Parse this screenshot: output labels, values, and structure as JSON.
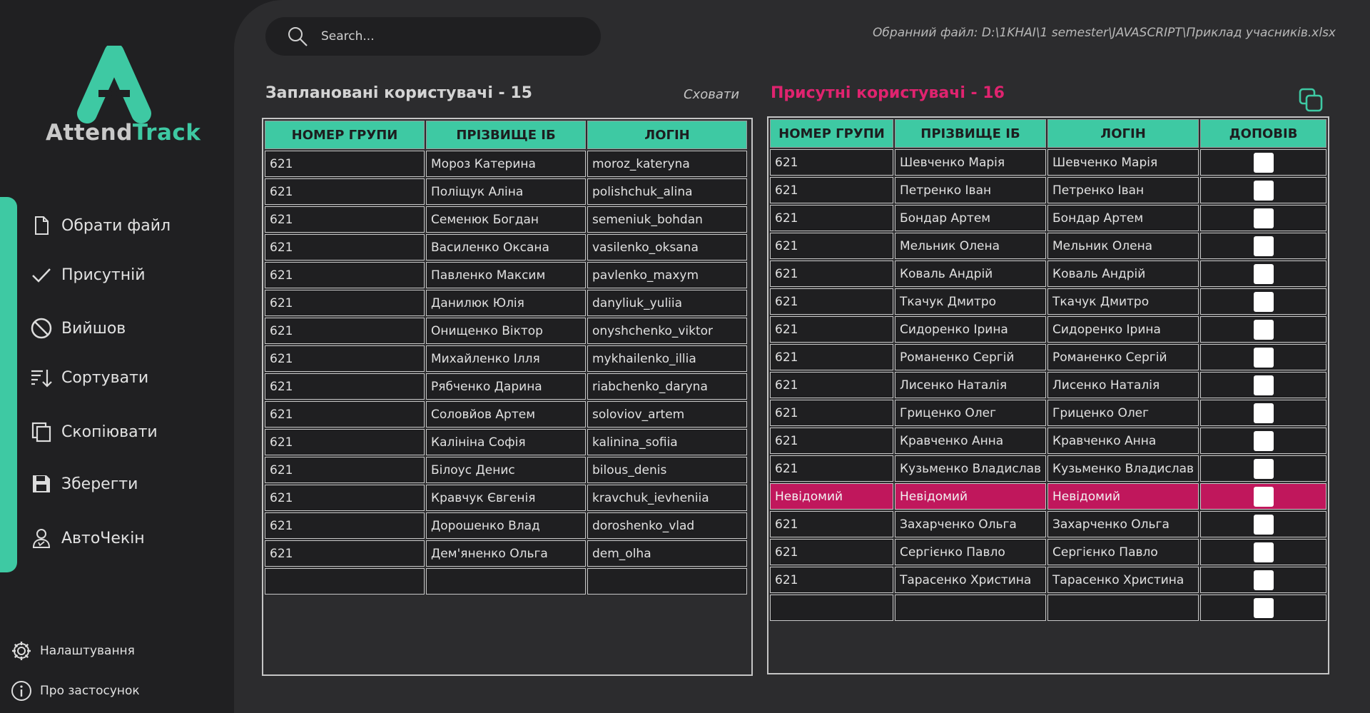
{
  "app": {
    "logo_part1": "Attend",
    "logo_part2": "Track"
  },
  "colors": {
    "accent": "#3ec9a3",
    "highlight": "#e0236f",
    "unknown_row": "#c0175c",
    "panel": "#2c2c2e",
    "sidebar": "#202022"
  },
  "sidebar": {
    "items": [
      {
        "label": "Обрати файл",
        "icon": "file-icon"
      },
      {
        "label": "Присутній",
        "icon": "check-icon"
      },
      {
        "label": "Вийшов",
        "icon": "block-icon"
      },
      {
        "label": "Сортувати",
        "icon": "sort-icon"
      },
      {
        "label": "Скопіювати",
        "icon": "copy-icon"
      },
      {
        "label": "Зберегти",
        "icon": "save-icon"
      },
      {
        "label": "АвтоЧекін",
        "icon": "user-icon"
      }
    ],
    "footer": [
      {
        "label": "Налаштування",
        "icon": "gear-icon"
      },
      {
        "label": "Про застосунок",
        "icon": "info-icon"
      }
    ]
  },
  "search": {
    "placeholder": "Search..."
  },
  "file_path": "Обранний файл: D:\\1KHAI\\1 semester\\JAVASCRIPT\\Приклад учасників.xlsx",
  "planned": {
    "title": "Заплановані користувачі - 15",
    "hide_label": "Сховати",
    "columns": [
      "НОМЕР ГРУПИ",
      "ПРІЗВИЩЕ ІБ",
      "ЛОГІН"
    ],
    "rows": [
      [
        "621",
        "Мороз Катерина",
        "moroz_kateryna"
      ],
      [
        "621",
        "Поліщук Аліна",
        "polishchuk_alina"
      ],
      [
        "621",
        "Семенюк Богдан",
        "semeniuk_bohdan"
      ],
      [
        "621",
        "Василенко Оксана",
        "vasilenko_oksana"
      ],
      [
        "621",
        "Павленко Максим",
        "pavlenko_maxym"
      ],
      [
        "621",
        "Данилюк Юлія",
        "danyliuk_yuliia"
      ],
      [
        "621",
        "Онищенко Віктор",
        "onyshchenko_viktor"
      ],
      [
        "621",
        "Михайленко Ілля",
        "mykhailenko_illia"
      ],
      [
        "621",
        "Рябченко Дарина",
        "riabchenko_daryna"
      ],
      [
        "621",
        "Соловйов Артем",
        "soloviov_artem"
      ],
      [
        "621",
        "Калініна Софія",
        "kalinina_sofiia"
      ],
      [
        "621",
        "Білоус Денис",
        "bilous_denis"
      ],
      [
        "621",
        "Кравчук Євгенія",
        "kravchuk_ievheniia"
      ],
      [
        "621",
        "Дорошенко Влад",
        "doroshenko_vlad"
      ],
      [
        "621",
        "Дем'яненко Ольга",
        "dem_olha"
      ],
      [
        "",
        "",
        ""
      ]
    ]
  },
  "present": {
    "title": "Присутні користувачі - 16",
    "columns": [
      "НОМЕР ГРУПИ",
      "ПРІЗВИЩЕ ІБ",
      "ЛОГІН",
      "ДОПОВІВ"
    ],
    "rows": [
      [
        "621",
        "Шевченко Марія",
        "Шевченко Марія"
      ],
      [
        "621",
        "Петренко Іван",
        "Петренко Іван"
      ],
      [
        "621",
        "Бондар Артем",
        "Бондар Артем"
      ],
      [
        "621",
        "Мельник Олена",
        "Мельник Олена"
      ],
      [
        "621",
        "Коваль Андрій",
        "Коваль Андрій"
      ],
      [
        "621",
        "Ткачук Дмитро",
        "Ткачук Дмитро"
      ],
      [
        "621",
        "Сидоренко Ірина",
        "Сидоренко Ірина"
      ],
      [
        "621",
        "Романенко Сергій",
        "Романенко Сергій"
      ],
      [
        "621",
        "Лисенко Наталія",
        "Лисенко Наталія"
      ],
      [
        "621",
        "Гриценко Олег",
        "Гриценко Олег"
      ],
      [
        "621",
        "Кравченко Анна",
        "Кравченко Анна"
      ],
      [
        "621",
        "Кузьменко Владислав",
        "Кузьменко Владислав"
      ],
      [
        "Невідомий",
        "Невідомий",
        "Невідомий"
      ],
      [
        "621",
        "Захарченко Ольга",
        "Захарченко Ольга"
      ],
      [
        "621",
        "Сергієнко Павло",
        "Сергієнко Павло"
      ],
      [
        "621",
        "Тарасенко Христина",
        "Тарасенко Христина"
      ],
      [
        "",
        "",
        ""
      ]
    ]
  }
}
